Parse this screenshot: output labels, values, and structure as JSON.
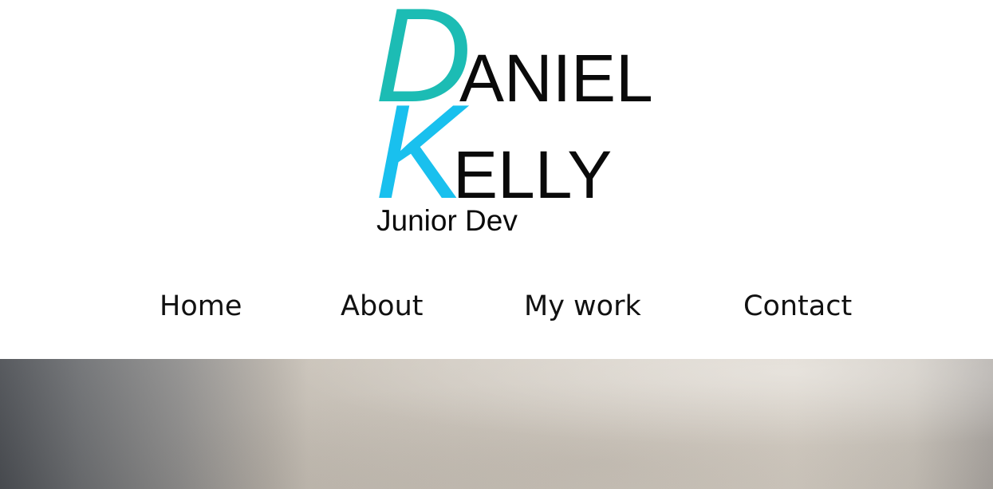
{
  "logo": {
    "initial_first": "D",
    "rest_first": "ANIEL",
    "initial_last": "K",
    "rest_last": "ELLY",
    "subtitle": "Junior Dev",
    "colors": {
      "initial_first": "#1cbcb4",
      "initial_last": "#19c0ee",
      "text": "#0a0a0a"
    }
  },
  "nav": {
    "items": [
      {
        "label": "Home"
      },
      {
        "label": "About"
      },
      {
        "label": "My work"
      },
      {
        "label": "Contact"
      }
    ]
  },
  "hero": {
    "image": "wall-with-plant-shadow-photo"
  }
}
